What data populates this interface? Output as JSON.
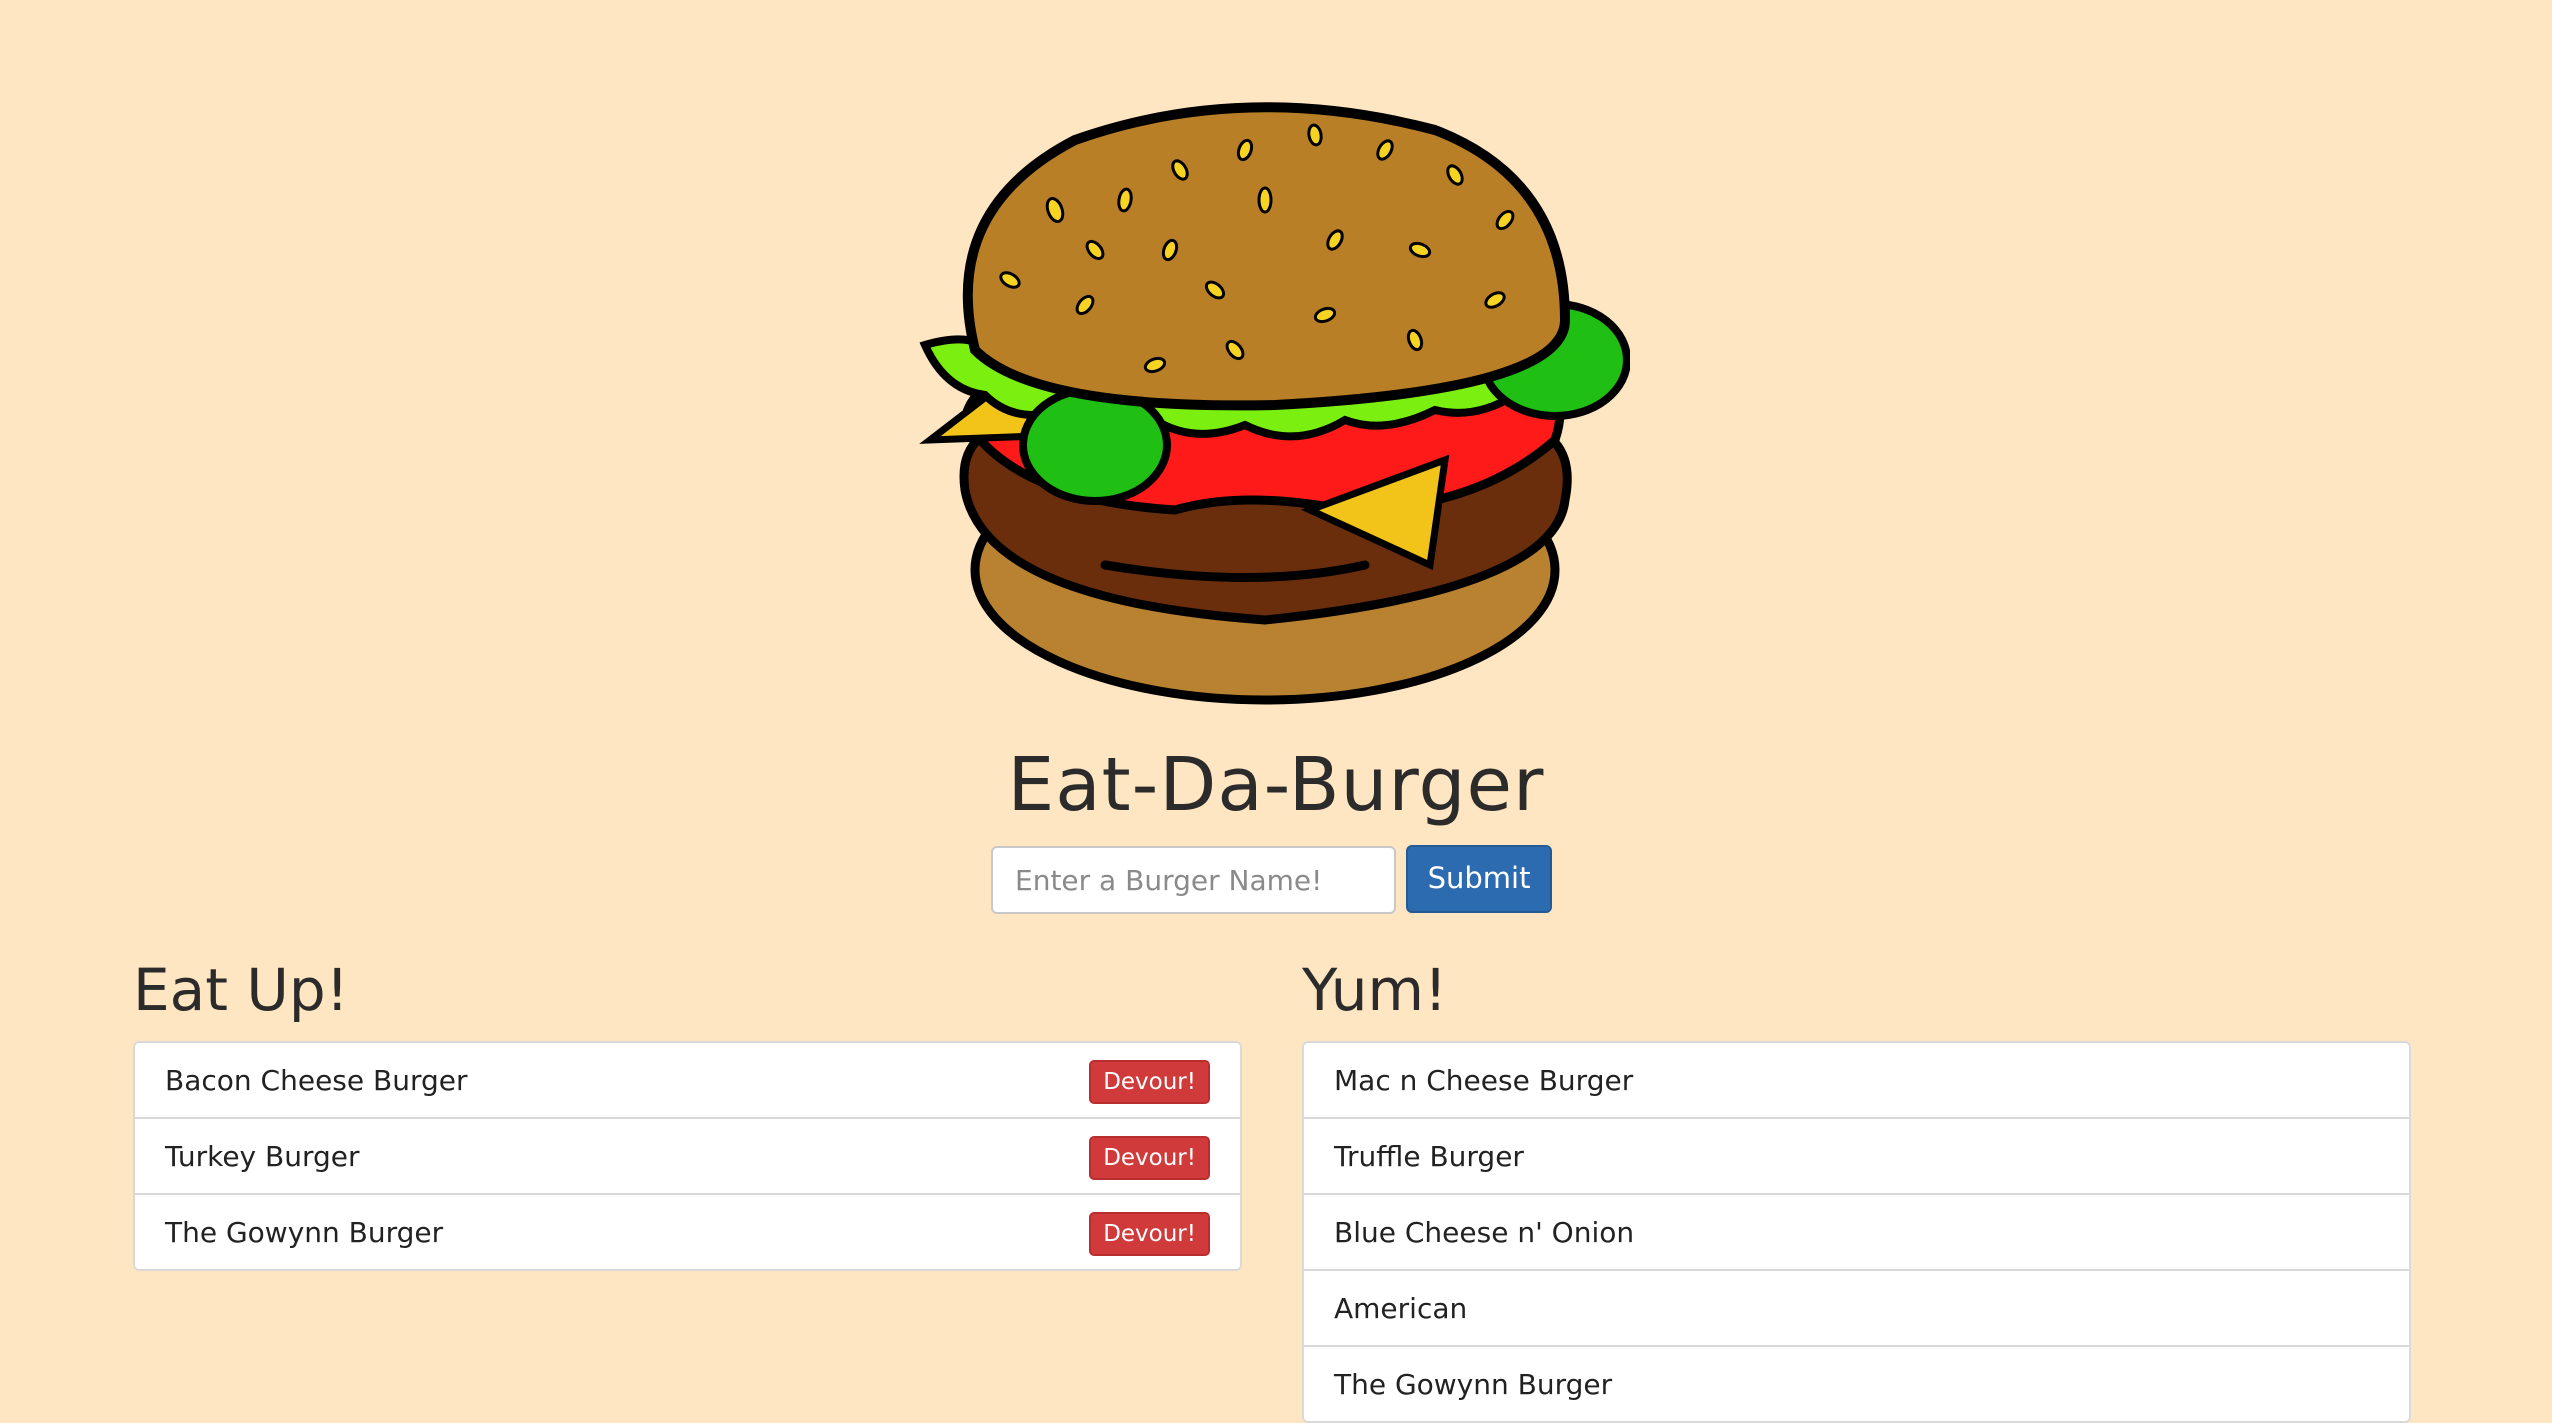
{
  "header": {
    "logo_icon": "burger-icon",
    "title": "Eat-Da-Burger"
  },
  "form": {
    "placeholder": "Enter a Burger Name!",
    "value": "",
    "submit_label": "Submit"
  },
  "eat_up": {
    "heading": "Eat Up!",
    "button_label": "Devour!",
    "items": [
      "Bacon Cheese Burger",
      "Turkey Burger",
      "The Gowynn Burger"
    ]
  },
  "yum": {
    "heading": "Yum!",
    "items": [
      "Mac n Cheese Burger",
      "Truffle Burger",
      "Blue Cheese n' Onion",
      "American",
      "The Gowynn Burger"
    ]
  },
  "colors": {
    "background": "#ffe6c2",
    "submit": "#2d6bb0",
    "devour": "#d03a3a"
  }
}
